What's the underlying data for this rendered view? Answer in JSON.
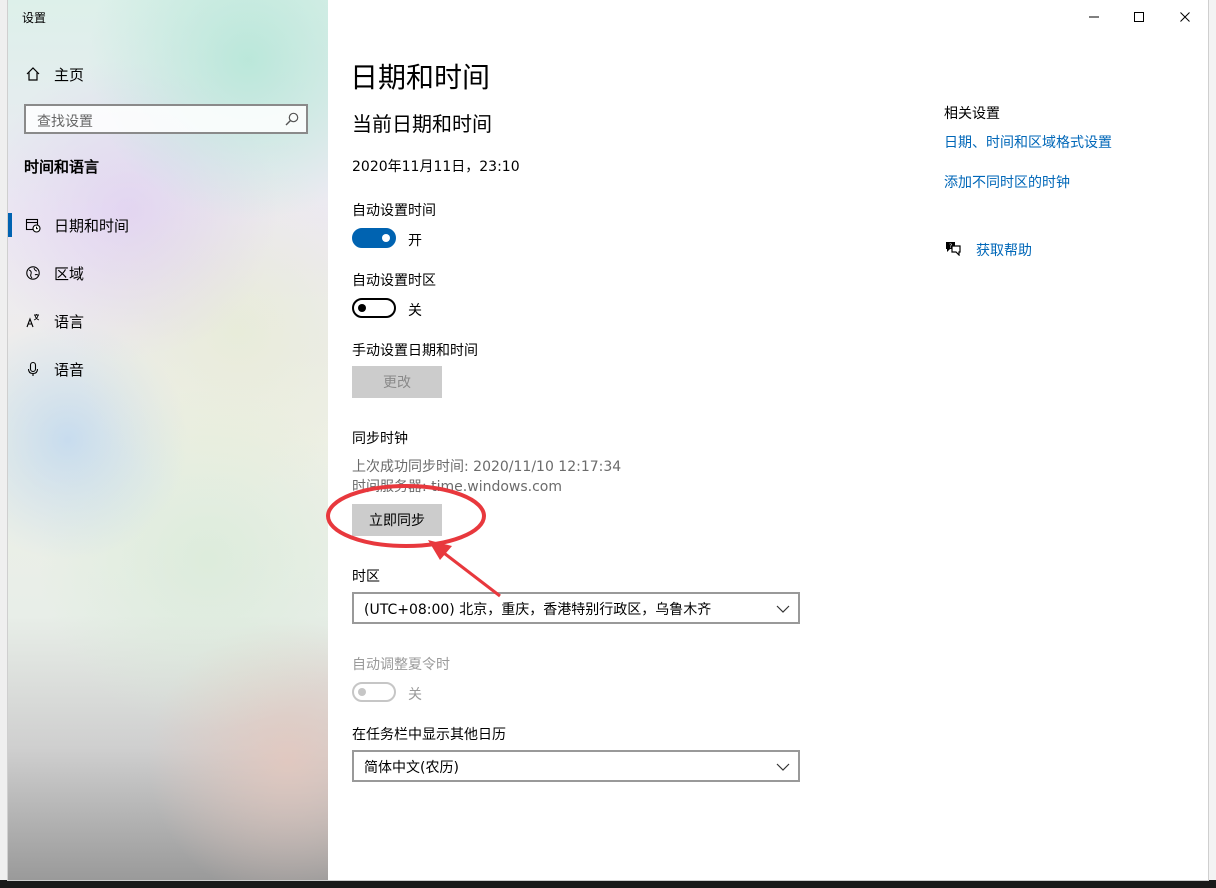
{
  "window": {
    "title": "设置"
  },
  "sidebar": {
    "home": "主页",
    "search_placeholder": "查找设置",
    "section": "时间和语言",
    "items": [
      {
        "label": "日期和时间",
        "active": true
      },
      {
        "label": "区域"
      },
      {
        "label": "语言"
      },
      {
        "label": "语音"
      }
    ]
  },
  "main": {
    "title": "日期和时间",
    "current_header": "当前日期和时间",
    "current_value": "2020年11月11日，23:10",
    "auto_time": {
      "label": "自动设置时间",
      "state": "开"
    },
    "auto_timezone": {
      "label": "自动设置时区",
      "state": "关"
    },
    "manual": {
      "label": "手动设置日期和时间",
      "button": "更改"
    },
    "sync": {
      "label": "同步时钟",
      "last_sync": "上次成功同步时间: 2020/11/10 12:17:34",
      "server": "时间服务器: time.windows.com",
      "button": "立即同步"
    },
    "timezone": {
      "label": "时区",
      "value": "(UTC+08:00) 北京，重庆，香港特别行政区，乌鲁木齐"
    },
    "dst": {
      "label": "自动调整夏令时",
      "state": "关"
    },
    "calendar": {
      "label": "在任务栏中显示其他日历",
      "value": "简体中文(农历)"
    }
  },
  "related": {
    "header": "相关设置",
    "links": [
      "日期、时间和区域格式设置",
      "添加不同时区的时钟"
    ],
    "help": "获取帮助"
  },
  "colors": {
    "accent": "#0063b1",
    "link": "#0067b8",
    "annotation": "#e8383d"
  }
}
